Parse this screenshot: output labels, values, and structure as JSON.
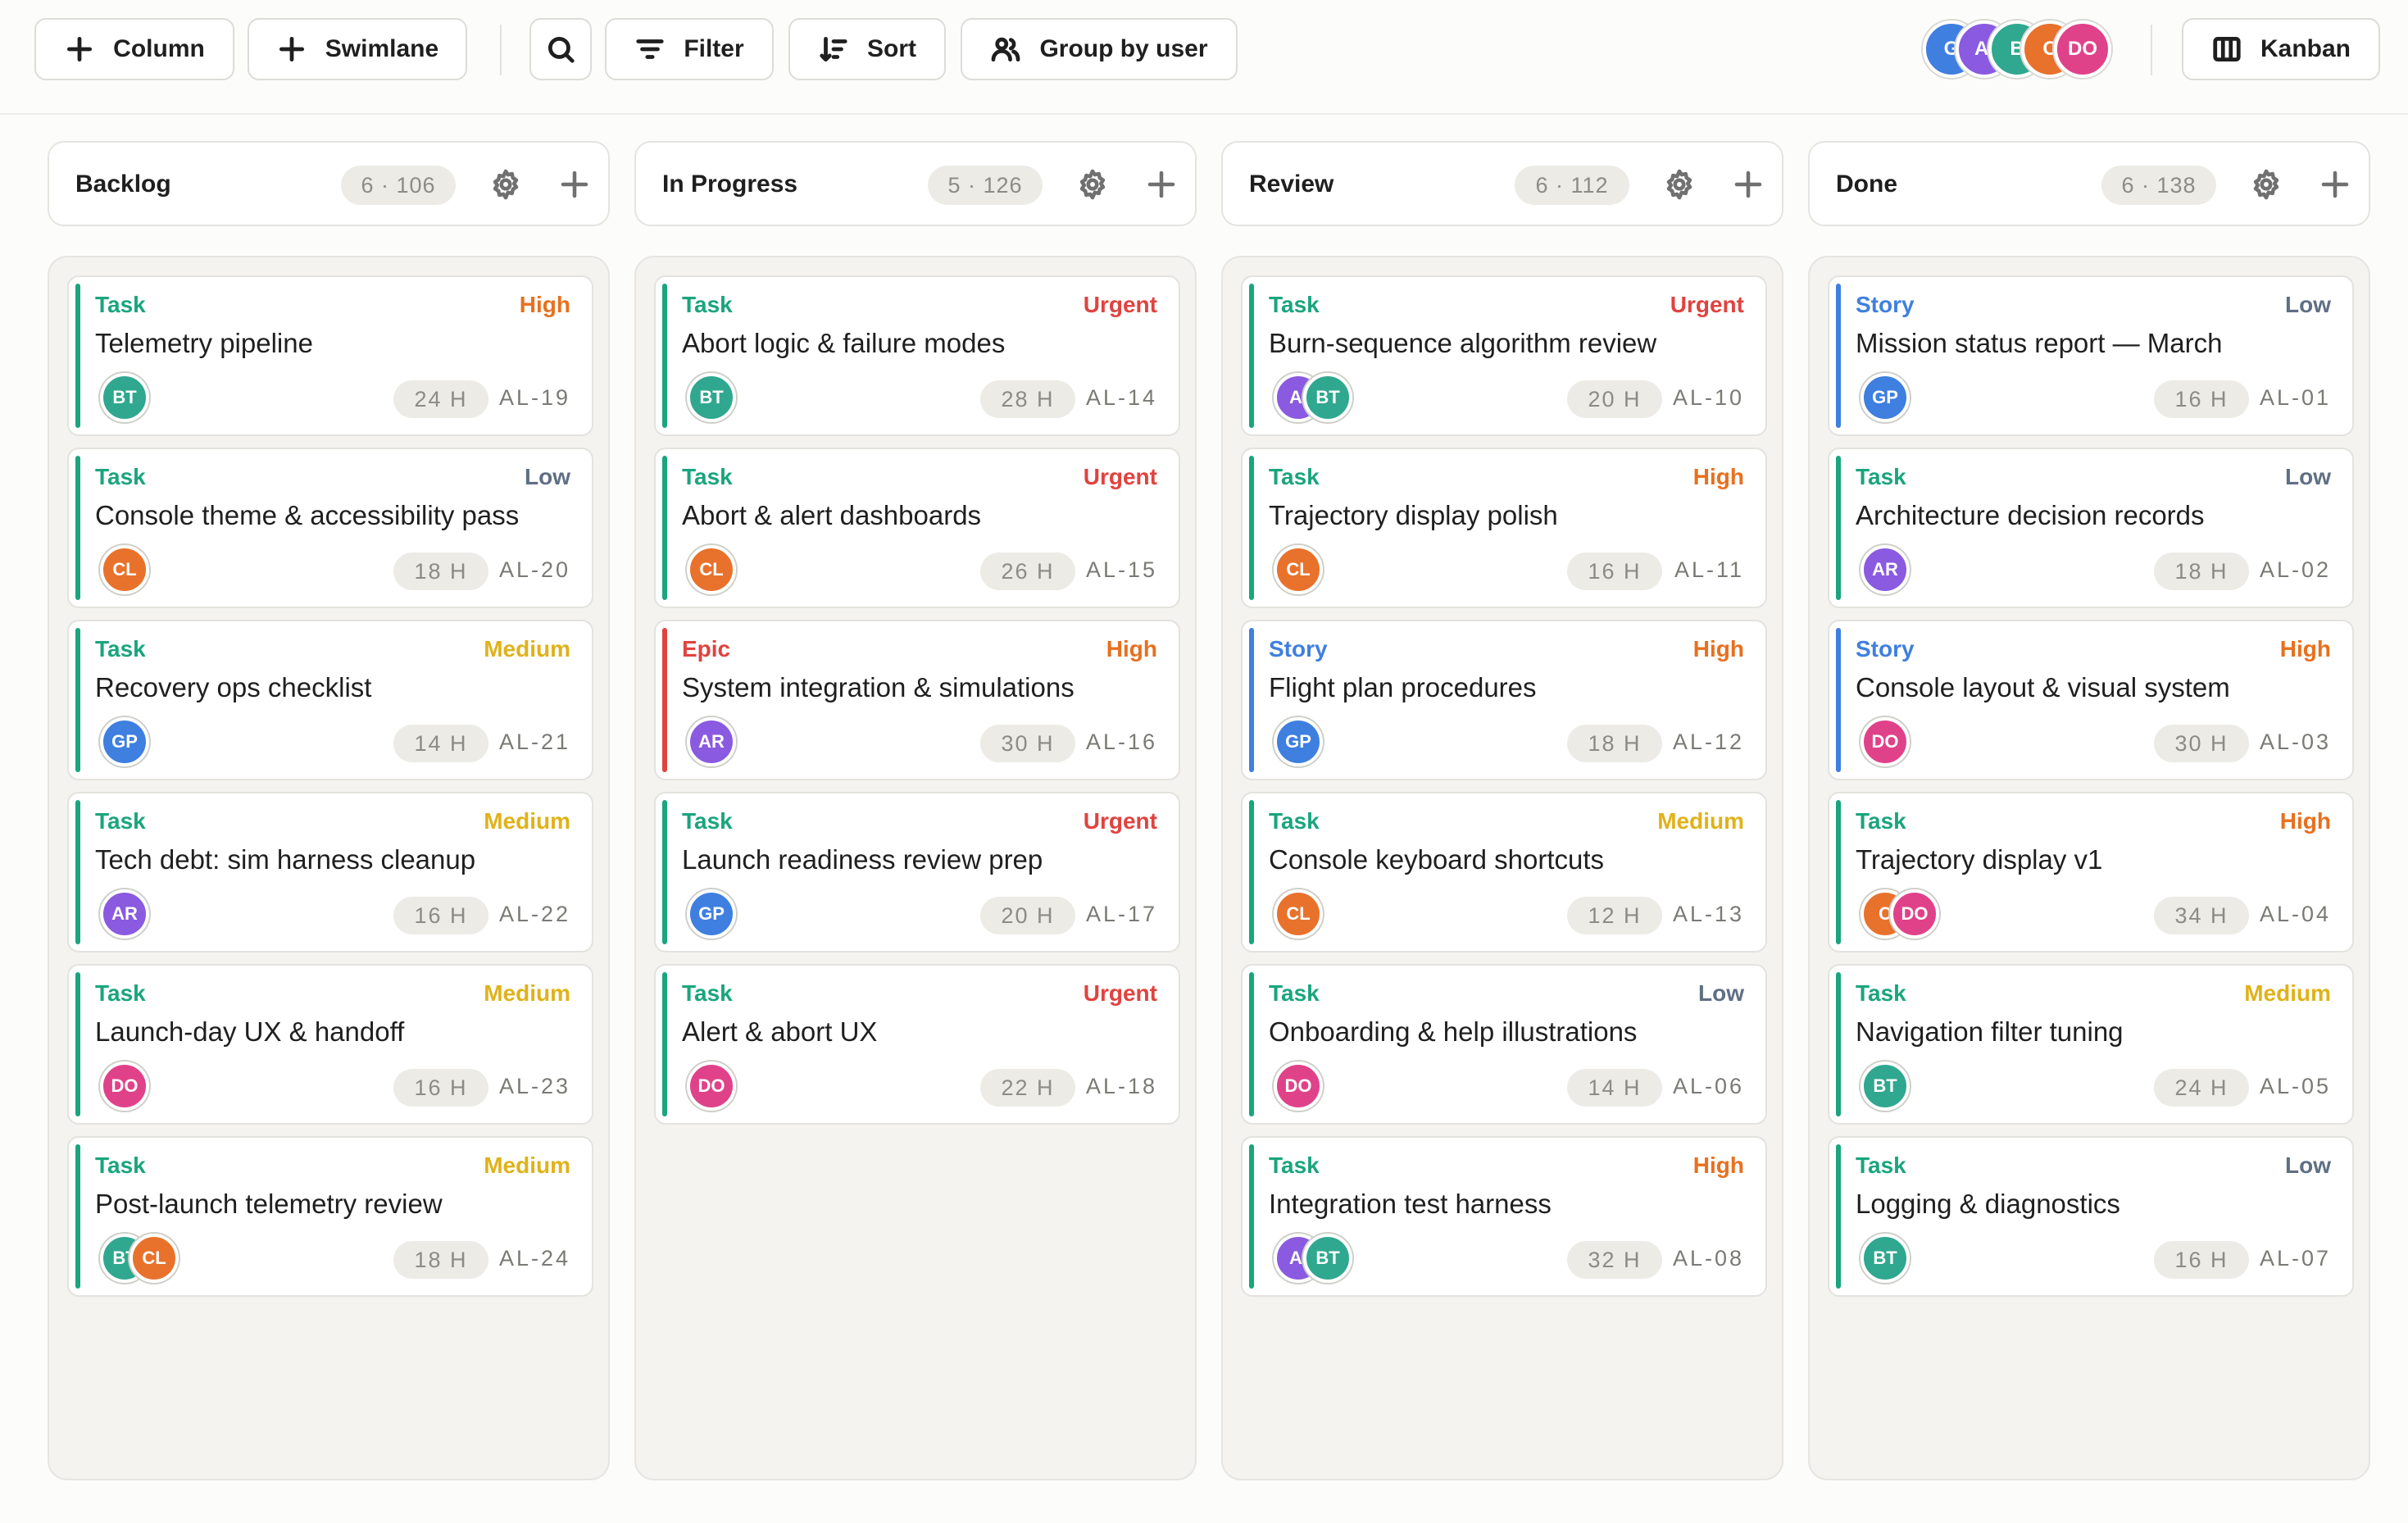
{
  "colors": {
    "task": "#1aa57e",
    "story": "#3f7fe0",
    "epic": "#e0433f",
    "urgent": "#e0433f",
    "high": "#e8701f",
    "medium": "#e0b21a",
    "low": "#5f6f84"
  },
  "users": {
    "BT": "#2fa88f",
    "CL": "#e8722c",
    "GP": "#3e7fe0",
    "AR": "#8a5ae0",
    "DO": "#e0428a",
    "G": "#3e7fe0",
    "AI": "#8a5ae0",
    "B": "#2fa88f",
    "C": "#e8722c"
  },
  "toolbar": {
    "add_column": "Column",
    "add_swimlane": "Swimlane",
    "filter": "Filter",
    "sort": "Sort",
    "group_by_user": "Group by user",
    "view": "Kanban",
    "avatars": [
      "G",
      "AI",
      "B",
      "C",
      "DO"
    ]
  },
  "columns": [
    {
      "title": "Backlog",
      "count": "6 · 106",
      "cards": [
        {
          "type": "Task",
          "priority": "High",
          "title": "Telemetry pipeline",
          "users": [
            "BT"
          ],
          "hours": "24 H",
          "key": "AL-19"
        },
        {
          "type": "Task",
          "priority": "Low",
          "title": "Console theme & accessibility pass",
          "users": [
            "CL"
          ],
          "hours": "18 H",
          "key": "AL-20"
        },
        {
          "type": "Task",
          "priority": "Medium",
          "title": "Recovery ops checklist",
          "users": [
            "GP"
          ],
          "hours": "14 H",
          "key": "AL-21"
        },
        {
          "type": "Task",
          "priority": "Medium",
          "title": "Tech debt: sim harness cleanup",
          "users": [
            "AR"
          ],
          "hours": "16 H",
          "key": "AL-22"
        },
        {
          "type": "Task",
          "priority": "Medium",
          "title": "Launch-day UX & handoff",
          "users": [
            "DO"
          ],
          "hours": "16 H",
          "key": "AL-23"
        },
        {
          "type": "Task",
          "priority": "Medium",
          "title": "Post-launch telemetry review",
          "users": [
            "BT",
            "CL"
          ],
          "hours": "18 H",
          "key": "AL-24"
        }
      ]
    },
    {
      "title": "In Progress",
      "count": "5 · 126",
      "cards": [
        {
          "type": "Task",
          "priority": "Urgent",
          "title": "Abort logic & failure modes",
          "users": [
            "BT"
          ],
          "hours": "28 H",
          "key": "AL-14"
        },
        {
          "type": "Task",
          "priority": "Urgent",
          "title": "Abort & alert dashboards",
          "users": [
            "CL"
          ],
          "hours": "26 H",
          "key": "AL-15"
        },
        {
          "type": "Epic",
          "priority": "High",
          "title": "System integration & simulations",
          "users": [
            "AR"
          ],
          "hours": "30 H",
          "key": "AL-16"
        },
        {
          "type": "Task",
          "priority": "Urgent",
          "title": "Launch readiness review prep",
          "users": [
            "GP"
          ],
          "hours": "20 H",
          "key": "AL-17"
        },
        {
          "type": "Task",
          "priority": "Urgent",
          "title": "Alert & abort UX",
          "users": [
            "DO"
          ],
          "hours": "22 H",
          "key": "AL-18"
        }
      ]
    },
    {
      "title": "Review",
      "count": "6 · 112",
      "cards": [
        {
          "type": "Task",
          "priority": "Urgent",
          "title": "Burn-sequence algorithm review",
          "users": [
            "AI",
            "BT"
          ],
          "hours": "20 H",
          "key": "AL-10"
        },
        {
          "type": "Task",
          "priority": "High",
          "title": "Trajectory display polish",
          "users": [
            "CL"
          ],
          "hours": "16 H",
          "key": "AL-11"
        },
        {
          "type": "Story",
          "priority": "High",
          "title": "Flight plan procedures",
          "users": [
            "GP"
          ],
          "hours": "18 H",
          "key": "AL-12"
        },
        {
          "type": "Task",
          "priority": "Medium",
          "title": "Console keyboard shortcuts",
          "users": [
            "CL"
          ],
          "hours": "12 H",
          "key": "AL-13"
        },
        {
          "type": "Task",
          "priority": "Low",
          "title": "Onboarding & help illustrations",
          "users": [
            "DO"
          ],
          "hours": "14 H",
          "key": "AL-06"
        },
        {
          "type": "Task",
          "priority": "High",
          "title": "Integration test harness",
          "users": [
            "AI",
            "BT"
          ],
          "hours": "32 H",
          "key": "AL-08"
        }
      ]
    },
    {
      "title": "Done",
      "count": "6 · 138",
      "cards": [
        {
          "type": "Story",
          "priority": "Low",
          "title": "Mission status report — March",
          "users": [
            "GP"
          ],
          "hours": "16 H",
          "key": "AL-01"
        },
        {
          "type": "Task",
          "priority": "Low",
          "title": "Architecture decision records",
          "users": [
            "AR"
          ],
          "hours": "18 H",
          "key": "AL-02"
        },
        {
          "type": "Story",
          "priority": "High",
          "title": "Console layout & visual system",
          "users": [
            "DO"
          ],
          "hours": "30 H",
          "key": "AL-03"
        },
        {
          "type": "Task",
          "priority": "High",
          "title": "Trajectory display v1",
          "users": [
            "C",
            "DO"
          ],
          "hours": "34 H",
          "key": "AL-04"
        },
        {
          "type": "Task",
          "priority": "Medium",
          "title": "Navigation filter tuning",
          "users": [
            "BT"
          ],
          "hours": "24 H",
          "key": "AL-05"
        },
        {
          "type": "Task",
          "priority": "Low",
          "title": "Logging & diagnostics",
          "users": [
            "BT"
          ],
          "hours": "16 H",
          "key": "AL-07"
        }
      ]
    }
  ]
}
